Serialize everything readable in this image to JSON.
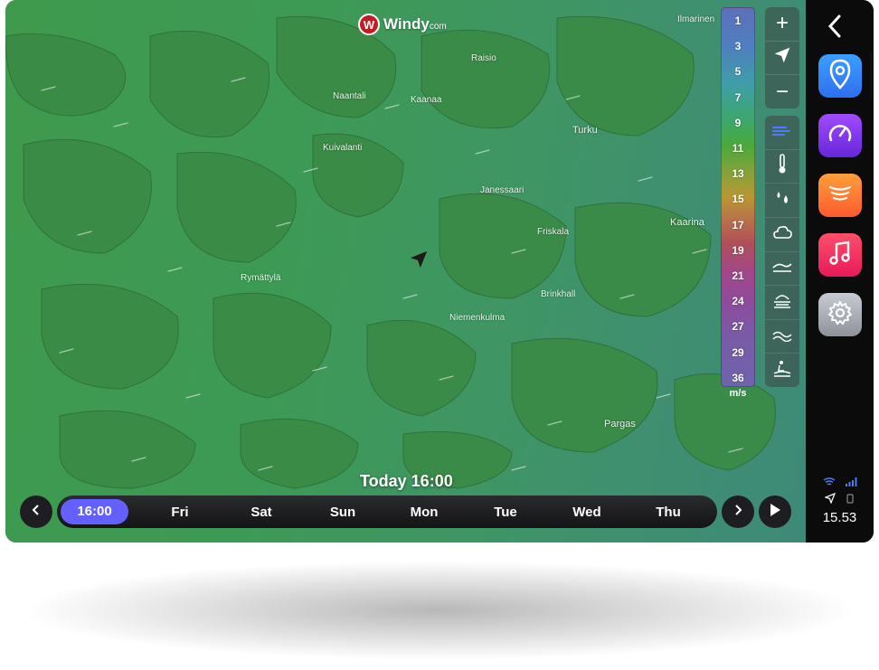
{
  "brand": {
    "logo_letter": "W",
    "name": "Windy",
    "suffix": "com"
  },
  "towns": [
    {
      "name": "Ilmarinen"
    },
    {
      "name": "Raisio"
    },
    {
      "name": "Naantali"
    },
    {
      "name": "Kaanaa"
    },
    {
      "name": "Turku"
    },
    {
      "name": "Kuivalanti"
    },
    {
      "name": "Janessaari"
    },
    {
      "name": "Kaarina"
    },
    {
      "name": "Friskala"
    },
    {
      "name": "Rymättylä"
    },
    {
      "name": "Brinkhall"
    },
    {
      "name": "Niemenkulma"
    },
    {
      "name": "Pargas"
    }
  ],
  "legend": {
    "values": [
      "1",
      "3",
      "5",
      "7",
      "9",
      "11",
      "13",
      "15",
      "17",
      "19",
      "21",
      "24",
      "27",
      "29",
      "36"
    ],
    "unit": "m/s"
  },
  "zoom": {
    "in": "+",
    "out": "−"
  },
  "layers": [
    "wind",
    "temperature",
    "rain",
    "clouds",
    "waves",
    "fog",
    "swell",
    "surf"
  ],
  "time_label": "Today 16:00",
  "timeline": {
    "days": [
      "16:00",
      "Fri",
      "Sat",
      "Sun",
      "Mon",
      "Tue",
      "Wed",
      "Thu"
    ]
  },
  "sidebar": {
    "apps": [
      "maps",
      "speedometer",
      "radio",
      "music",
      "settings"
    ],
    "clock": "15.53"
  },
  "colors": {
    "accent": "#6460ff",
    "sidebar": "#0b0b0b",
    "map_green": "#3f9a4d"
  }
}
